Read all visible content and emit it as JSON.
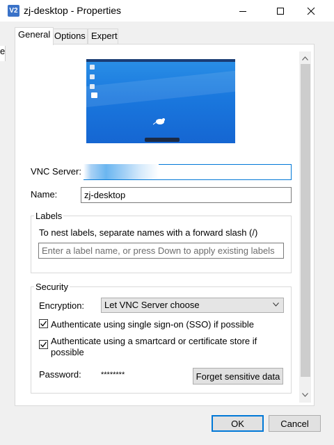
{
  "window": {
    "app_icon_text": "V2",
    "title": "zj-desktop - Properties",
    "minimize_icon": "minimize-icon",
    "maximize_icon": "maximize-icon",
    "close_icon": "close-icon"
  },
  "behind_window_text": "e",
  "tabs": [
    {
      "label": "General",
      "active": true
    },
    {
      "label": "Options",
      "active": false
    },
    {
      "label": "Expert",
      "active": false
    }
  ],
  "general": {
    "vnc_server_label": "VNC Server:",
    "vnc_server_value": "",
    "name_label": "Name:",
    "name_value": "zj-desktop",
    "labels_group": {
      "title": "Labels",
      "hint": "To nest labels, separate names with a forward slash (/)",
      "input_placeholder": "Enter a label name, or press Down to apply existing labels"
    },
    "security_group": {
      "title": "Security",
      "encryption_label": "Encryption:",
      "encryption_value": "Let VNC Server choose",
      "sso_checkbox": {
        "label": "Authenticate using single sign-on (SSO) if possible",
        "checked": true
      },
      "smartcard_checkbox": {
        "label_line1": "Authenticate using a smartcard or certificate store if",
        "label_line2": "possible",
        "checked": true
      },
      "password_label": "Password:",
      "password_value": "********",
      "forget_button": "Forget sensitive data"
    }
  },
  "footer": {
    "ok_label": "OK",
    "cancel_label": "Cancel"
  },
  "colors": {
    "accent": "#0078d7",
    "desktop_blue": "#1a78de",
    "app_icon": "#3a72c8"
  }
}
